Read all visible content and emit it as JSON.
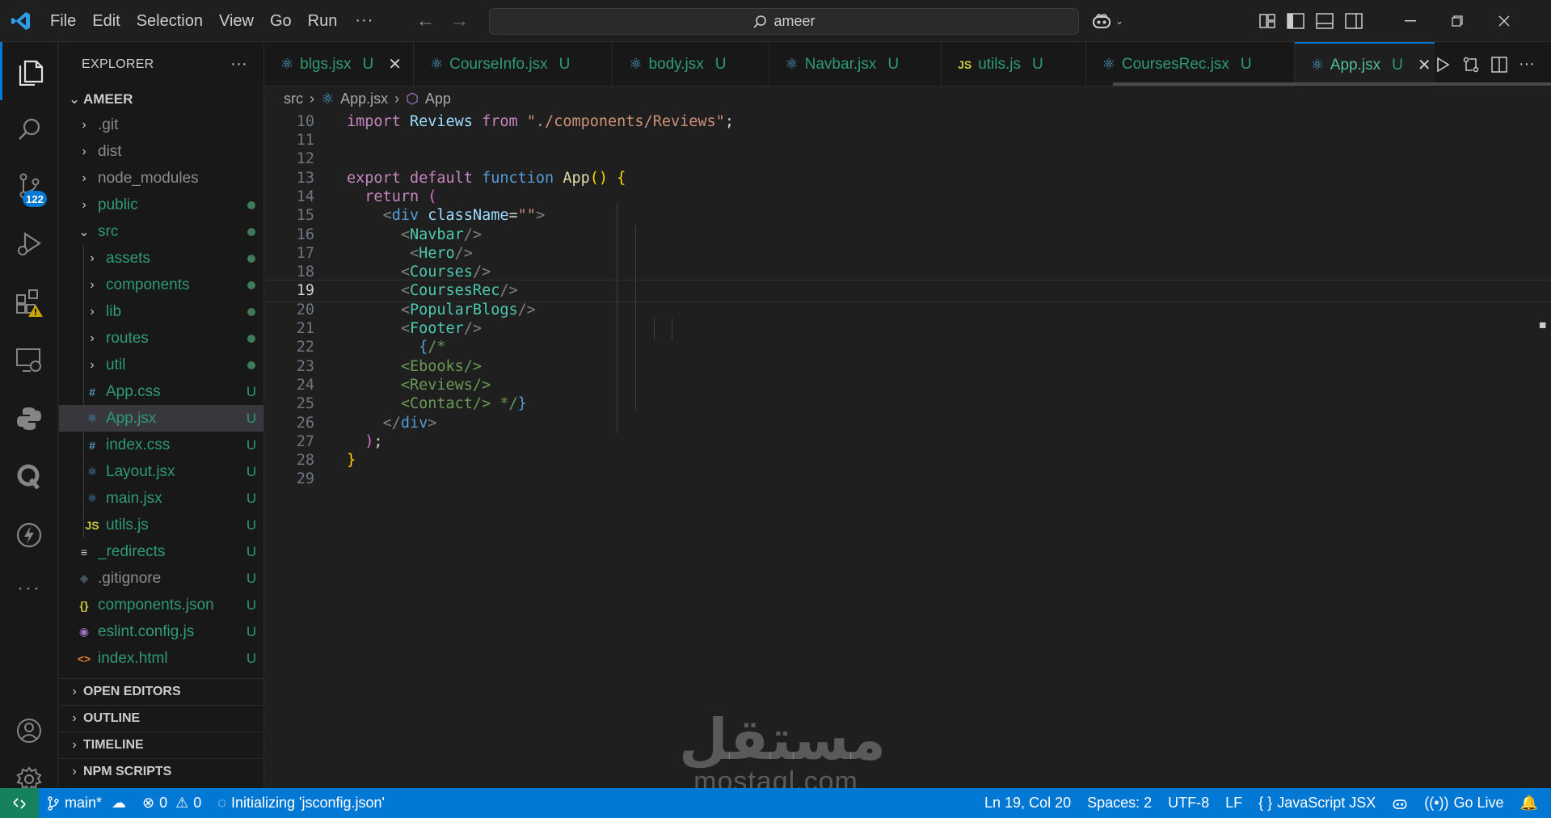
{
  "titlebar": {
    "menus": [
      "File",
      "Edit",
      "Selection",
      "View",
      "Go",
      "Run"
    ],
    "more": "···",
    "search": "ameer"
  },
  "activity": {
    "scm_badge": "122"
  },
  "explorer": {
    "header": "EXPLORER",
    "more": "···",
    "root": "AMEER",
    "items": [
      {
        "label": ".git",
        "type": "folder",
        "status": ""
      },
      {
        "label": "dist",
        "type": "folder",
        "status": ""
      },
      {
        "label": "node_modules",
        "type": "folder",
        "status": ""
      },
      {
        "label": "public",
        "type": "folder",
        "status": "dot"
      },
      {
        "label": "src",
        "type": "folder-open",
        "status": "dot"
      },
      {
        "label": "assets",
        "type": "folder",
        "status": "dot"
      },
      {
        "label": "components",
        "type": "folder",
        "status": "dot"
      },
      {
        "label": "lib",
        "type": "folder",
        "status": "dot"
      },
      {
        "label": "routes",
        "type": "folder",
        "status": "dot"
      },
      {
        "label": "util",
        "type": "folder",
        "status": "dot"
      },
      {
        "label": "App.css",
        "type": "css",
        "status": "U"
      },
      {
        "label": "App.jsx",
        "type": "react",
        "status": "U"
      },
      {
        "label": "index.css",
        "type": "css",
        "status": "U"
      },
      {
        "label": "Layout.jsx",
        "type": "react",
        "status": "U"
      },
      {
        "label": "main.jsx",
        "type": "react",
        "status": "U"
      },
      {
        "label": "utils.js",
        "type": "js",
        "status": "U"
      },
      {
        "label": "_redirects",
        "type": "text",
        "status": "U"
      },
      {
        "label": ".gitignore",
        "type": "git",
        "status": "U"
      },
      {
        "label": "components.json",
        "type": "json",
        "status": "U"
      },
      {
        "label": "eslint.config.js",
        "type": "eslint",
        "status": "U"
      },
      {
        "label": "index.html",
        "type": "html",
        "status": "U"
      }
    ],
    "sections": [
      "OPEN EDITORS",
      "OUTLINE",
      "TIMELINE",
      "NPM SCRIPTS"
    ]
  },
  "tabs": [
    {
      "label": "blgs.jsx",
      "icon": "react",
      "status": "U",
      "close": "✕"
    },
    {
      "label": "CourseInfo.jsx",
      "icon": "react",
      "status": "U",
      "close": ""
    },
    {
      "label": "body.jsx",
      "icon": "react",
      "status": "U",
      "close": ""
    },
    {
      "label": "Navbar.jsx",
      "icon": "react",
      "status": "U",
      "close": ""
    },
    {
      "label": "utils.js",
      "icon": "js",
      "status": "U",
      "close": ""
    },
    {
      "label": "CoursesRec.jsx",
      "icon": "react",
      "status": "U",
      "close": ""
    },
    {
      "label": "App.jsx",
      "icon": "react",
      "status": "U",
      "close": "✕",
      "active": true
    }
  ],
  "breadcrumb": {
    "folder": "src",
    "file": "App.jsx",
    "symbol": "App"
  },
  "editor": {
    "current_line": 19,
    "lines": [
      {
        "n": "10",
        "tokens": [
          [
            "kw",
            "import"
          ],
          [
            "plain",
            " "
          ],
          [
            "id",
            "Reviews"
          ],
          [
            "plain",
            " "
          ],
          [
            "kw",
            "from"
          ],
          [
            "plain",
            " "
          ],
          [
            "str",
            "\"./components/Reviews\""
          ],
          [
            "plain",
            ";"
          ]
        ]
      },
      {
        "n": "11",
        "tokens": []
      },
      {
        "n": "12",
        "tokens": []
      },
      {
        "n": "13",
        "tokens": [
          [
            "kw",
            "export"
          ],
          [
            "plain",
            " "
          ],
          [
            "kw",
            "default"
          ],
          [
            "plain",
            " "
          ],
          [
            "kw2",
            "function"
          ],
          [
            "plain",
            " "
          ],
          [
            "fn",
            "App"
          ],
          [
            "paren",
            "()"
          ],
          [
            "plain",
            " "
          ],
          [
            "paren",
            "{"
          ]
        ]
      },
      {
        "n": "14",
        "tokens": [
          [
            "plain",
            "  "
          ],
          [
            "kw",
            "return"
          ],
          [
            "plain",
            " "
          ],
          [
            "brace",
            "("
          ]
        ]
      },
      {
        "n": "15",
        "tokens": [
          [
            "plain",
            "    "
          ],
          [
            "pun",
            "<"
          ],
          [
            "jsxb",
            "div"
          ],
          [
            "plain",
            " "
          ],
          [
            "id",
            "className"
          ],
          [
            "plain",
            "="
          ],
          [
            "str",
            "\"\""
          ],
          [
            "pun",
            ">"
          ]
        ]
      },
      {
        "n": "16",
        "tokens": [
          [
            "plain",
            "      "
          ],
          [
            "pun",
            "<"
          ],
          [
            "tag",
            "Navbar"
          ],
          [
            "pun",
            "/>"
          ]
        ]
      },
      {
        "n": "17",
        "tokens": [
          [
            "plain",
            "       "
          ],
          [
            "pun",
            "<"
          ],
          [
            "tag",
            "Hero"
          ],
          [
            "pun",
            "/>"
          ]
        ]
      },
      {
        "n": "18",
        "tokens": [
          [
            "plain",
            "      "
          ],
          [
            "pun",
            "<"
          ],
          [
            "tag",
            "Courses"
          ],
          [
            "pun",
            "/>"
          ]
        ]
      },
      {
        "n": "19",
        "tokens": [
          [
            "plain",
            "      "
          ],
          [
            "pun",
            "<"
          ],
          [
            "tag",
            "CoursesRec"
          ],
          [
            "pun",
            "/>"
          ]
        ]
      },
      {
        "n": "20",
        "tokens": [
          [
            "plain",
            "      "
          ],
          [
            "pun",
            "<"
          ],
          [
            "tag",
            "PopularBlogs"
          ],
          [
            "pun",
            "/>"
          ]
        ]
      },
      {
        "n": "21",
        "tokens": [
          [
            "plain",
            "      "
          ],
          [
            "pun",
            "<"
          ],
          [
            "tag",
            "Footer"
          ],
          [
            "pun",
            "/>"
          ]
        ]
      },
      {
        "n": "22",
        "tokens": [
          [
            "plain",
            "        "
          ],
          [
            "jsxb",
            "{"
          ],
          [
            "cmt",
            "/*"
          ]
        ]
      },
      {
        "n": "23",
        "tokens": [
          [
            "plain",
            "      "
          ],
          [
            "cmt",
            "<Ebooks/>"
          ]
        ]
      },
      {
        "n": "24",
        "tokens": [
          [
            "plain",
            "      "
          ],
          [
            "cmt",
            "<Reviews/>"
          ]
        ]
      },
      {
        "n": "25",
        "tokens": [
          [
            "plain",
            "      "
          ],
          [
            "cmt",
            "<Contact/> */"
          ],
          [
            "jsxb",
            "}"
          ]
        ]
      },
      {
        "n": "26",
        "tokens": [
          [
            "plain",
            "    "
          ],
          [
            "pun",
            "</"
          ],
          [
            "jsxb",
            "div"
          ],
          [
            "pun",
            ">"
          ]
        ]
      },
      {
        "n": "27",
        "tokens": [
          [
            "plain",
            "  "
          ],
          [
            "brace",
            ")"
          ],
          [
            "plain",
            ";"
          ]
        ]
      },
      {
        "n": "28",
        "tokens": [
          [
            "paren",
            "}"
          ]
        ]
      },
      {
        "n": "29",
        "tokens": []
      }
    ]
  },
  "statusbar": {
    "branch": "main*",
    "errors": "0",
    "warnings": "0",
    "task": "Initializing 'jsconfig.json'",
    "position": "Ln 19, Col 20",
    "spaces": "Spaces: 2",
    "encoding": "UTF-8",
    "eol": "LF",
    "language": "JavaScript JSX",
    "golive": "Go Live"
  },
  "watermark": {
    "arabic": "مستقل",
    "latin": "mostaql.com"
  },
  "colors": {
    "accent": "#0078d4",
    "untracked": "#2e9a78",
    "statusbar": "#0078d4"
  }
}
